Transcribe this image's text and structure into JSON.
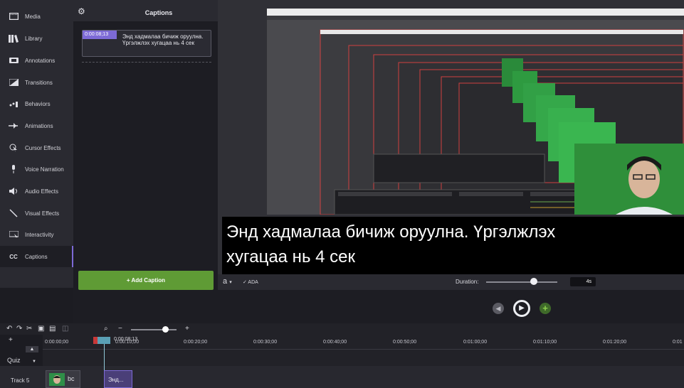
{
  "sidebar": {
    "items": [
      {
        "label": "Media",
        "icon": "media-icon"
      },
      {
        "label": "Library",
        "icon": "library-icon"
      },
      {
        "label": "Annotations",
        "icon": "annotation-icon"
      },
      {
        "label": "Transitions",
        "icon": "transition-icon"
      },
      {
        "label": "Behaviors",
        "icon": "behavior-icon"
      },
      {
        "label": "Animations",
        "icon": "animation-icon"
      },
      {
        "label": "Cursor Effects",
        "icon": "cursor-icon"
      },
      {
        "label": "Voice Narration",
        "icon": "microphone-icon"
      },
      {
        "label": "Audio Effects",
        "icon": "speaker-icon"
      },
      {
        "label": "Visual Effects",
        "icon": "wand-icon"
      },
      {
        "label": "Interactivity",
        "icon": "interactivity-icon"
      },
      {
        "label": "Captions",
        "icon": "cc-icon",
        "icon_text": "CC"
      }
    ]
  },
  "captions_panel": {
    "title": "Captions",
    "item": {
      "time": "0:00:08;13",
      "text": "Энд хадмалаа бичиж оруулна. Үргэлжлэх хугацаа нь 4 сек"
    },
    "add_button": "+ Add Caption"
  },
  "canvas": {
    "caption_line1": "Энд хадмалаа бичиж оруулна. Үргэлжлэх",
    "caption_line2": "хугацаа нь 4 сек"
  },
  "caption_tools": {
    "font_button": "a",
    "font_dropdown": "▾",
    "ada": "✓ ADA",
    "duration_label": "Duration:",
    "duration_value": "4s",
    "duration_level": 0.67
  },
  "timeline": {
    "playhead_time": "0:00:08;13",
    "ruler_labels": [
      "0:00:00;00",
      "0:00:10;00",
      "0:00:20;00",
      "0:00:30;00",
      "0:00:40;00",
      "0:00:50;00",
      "0:01:00;00",
      "0:01:10;00",
      "0:01:20;00",
      "0:01"
    ],
    "quiz_label": "Quiz",
    "track_label": "Track 5",
    "media_clip_label": "bc",
    "caption_clip_label": "Энд..."
  }
}
